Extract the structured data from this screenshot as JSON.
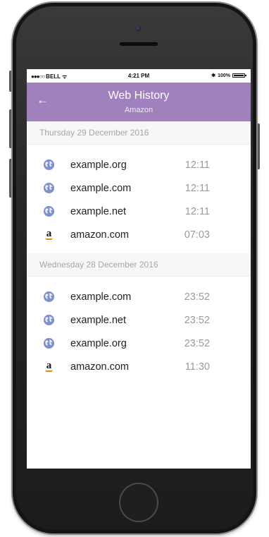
{
  "status_bar": {
    "signal_dots": "●●●○○",
    "carrier": "BELL",
    "wifi_glyph": "ᯤ",
    "time": "4:21 PM",
    "bluetooth_glyph": "✱",
    "battery_percent": "100%",
    "battery_level": 1.0
  },
  "header": {
    "back_glyph": "←",
    "title": "Web History",
    "subtitle": "Amazon",
    "background_color": "#a081be"
  },
  "sections": [
    {
      "date_label": "Thursday 29 December 2016",
      "entries": [
        {
          "icon": "globe-icon",
          "domain": "example.org",
          "time": "12:11"
        },
        {
          "icon": "globe-icon",
          "domain": "example.com",
          "time": "12:11"
        },
        {
          "icon": "globe-icon",
          "domain": "example.net",
          "time": "12:11"
        },
        {
          "icon": "amazon-icon",
          "icon_glyph": "a",
          "domain": "amazon.com",
          "time": "07:03"
        }
      ]
    },
    {
      "date_label": "Wednesday 28 December 2016",
      "entries": [
        {
          "icon": "globe-icon",
          "domain": "example.com",
          "time": "23:52"
        },
        {
          "icon": "globe-icon",
          "domain": "example.net",
          "time": "23:52"
        },
        {
          "icon": "globe-icon",
          "domain": "example.org",
          "time": "23:52"
        },
        {
          "icon": "amazon-icon",
          "icon_glyph": "a",
          "domain": "amazon.com",
          "time": "11:30"
        }
      ]
    }
  ]
}
